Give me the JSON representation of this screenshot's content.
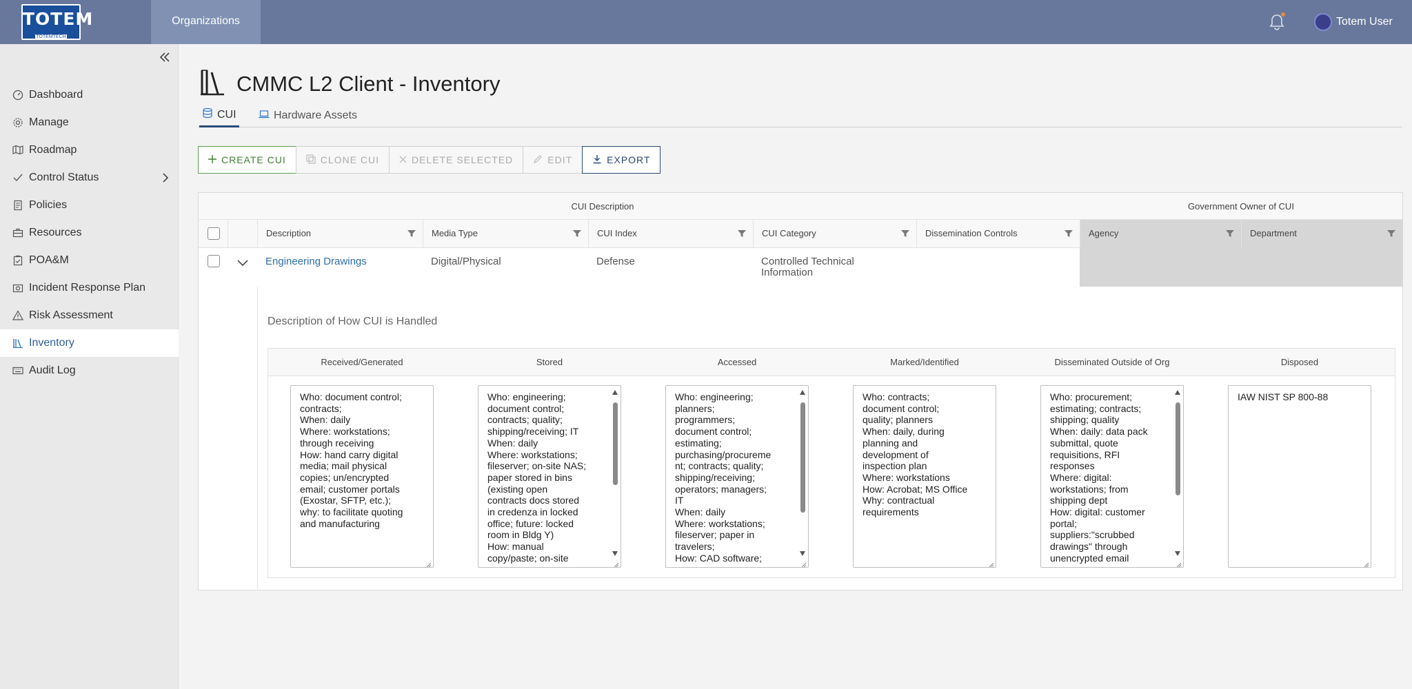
{
  "app": {
    "logo_text": "TOTEM",
    "logo_sub": "TOTEMTECH",
    "nav_top": "Organizations",
    "user_name": "Totem User"
  },
  "sidebar": {
    "items": [
      {
        "label": "Dashboard",
        "icon": "dashboard-icon"
      },
      {
        "label": "Manage",
        "icon": "gear-icon"
      },
      {
        "label": "Roadmap",
        "icon": "map-icon"
      },
      {
        "label": "Control Status",
        "icon": "check-icon"
      },
      {
        "label": "Policies",
        "icon": "document-icon"
      },
      {
        "label": "Resources",
        "icon": "briefcase-icon"
      },
      {
        "label": "POA&M",
        "icon": "clipboard-icon"
      },
      {
        "label": "Incident Response Plan",
        "icon": "camera-icon"
      },
      {
        "label": "Risk Assessment",
        "icon": "warning-icon"
      },
      {
        "label": "Inventory",
        "icon": "books-icon",
        "active": true
      },
      {
        "label": "Audit Log",
        "icon": "keyboard-icon"
      }
    ]
  },
  "page": {
    "title": "CMMC L2 Client - Inventory",
    "tabs": [
      {
        "label": "CUI",
        "active": true
      },
      {
        "label": "Hardware Assets",
        "active": false
      }
    ]
  },
  "toolbar": {
    "create": "CREATE CUI",
    "clone": "CLONE CUI",
    "delete": "DELETE SELECTED",
    "edit": "EDIT",
    "export": "EXPORT"
  },
  "grid": {
    "groups": {
      "cui_description": "CUI Description",
      "gov_owner": "Government Owner of CUI"
    },
    "columns": [
      "Description",
      "Media Type",
      "CUI Index",
      "CUI Category",
      "Dissemination Controls",
      "Agency",
      "Department"
    ],
    "row": {
      "description": "Engineering Drawings",
      "media_type": "Digital/Physical",
      "cui_index": "Defense",
      "cui_category_line1": "Controlled Technical",
      "cui_category_line2": "Information",
      "dissemination_controls": "",
      "agency": "",
      "department": ""
    },
    "detail": {
      "title": "Description of How CUI is Handled",
      "columns": [
        "Received/Generated",
        "Stored",
        "Accessed",
        "Marked/Identified",
        "Disseminated Outside of Org",
        "Disposed"
      ],
      "values": [
        "Who: document control;\ncontracts;\nWhen: daily\nWhere: workstations;\nthrough receiving\nHow: hand carry digital\nmedia; mail physical\ncopies; un/encrypted\nemail; customer portals\n(Exostar, SFTP, etc.);\nwhy: to facilitate quoting\nand manufacturing",
        "Who: engineering;\ndocument control;\ncontracts; quality;\nshipping/receiving; IT\nWhen: daily\nWhere: workstations;\nfileserver; on-site NAS;\npaper stored in bins\n(existing open\ncontracts docs stored\nin credenza in locked\noffice; future: locked\nroom in Bldg Y)\nHow: manual\ncopy/paste; on-site",
        "Who: engineering;\nplanners;\nprogrammers;\ndocument control;\nestimating;\npurchasing/procureme\nnt; contracts; quality;\nshipping/receiving;\noperators; managers;\nIT\nWhen: daily\nWhere: workstations;\nfileserver; paper in\ntravelers;\nHow: CAD software;",
        "Who: contracts;\ndocument control;\nquality; planners\nWhen: daily, during\nplanning and\ndevelopment of\ninspection plan\nWhere: workstations\nHow: Acrobat; MS Office\nWhy: contractual\nrequirements",
        "Who: procurement;\nestimating; contracts;\nshipping; quality\nWhen: daily: data pack\nsubmittal, quote\nrequisitions, RFI\nresponses\nWhere: digital:\nworkstations; from\nshipping dept\nHow: digital: customer\nportal;\nsuppliers:\"scrubbed\ndrawings\" through\nunencrypted email",
        "IAW NIST SP 800-88"
      ]
    }
  },
  "colors": {
    "topbar": "#68789c",
    "accent_blue": "#2a4a78",
    "create_green": "#3f7f33",
    "link": "#2f6fa8"
  }
}
